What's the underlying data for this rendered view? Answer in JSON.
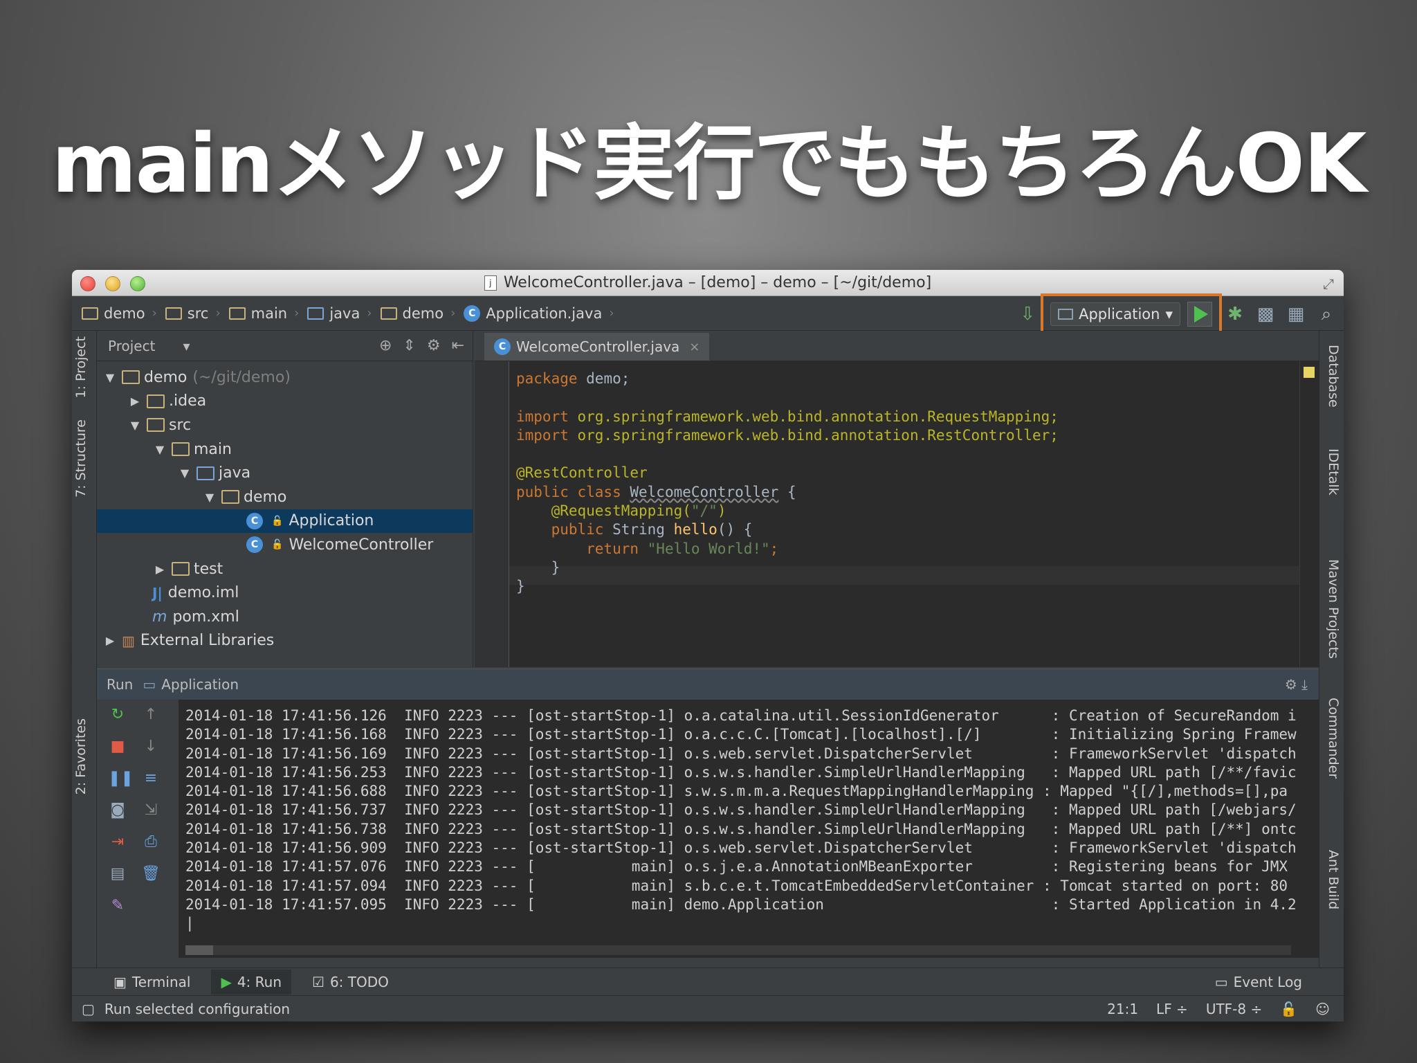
{
  "slide": {
    "title": "mainメソッド実行でももちろんOK"
  },
  "window": {
    "title": "WelcomeController.java – [demo] – demo – [~/git/demo]"
  },
  "breadcrumb": [
    "demo",
    "src",
    "main",
    "java",
    "demo",
    "Application.java"
  ],
  "toolbar": {
    "run_config": "Application"
  },
  "left_tabs": [
    "1: Project",
    "7: Structure",
    "2: Favorites"
  ],
  "right_tabs": [
    "Database",
    "IDEtalk",
    "Maven Projects",
    "Commander",
    "Ant Build"
  ],
  "project_panel": {
    "header": "Project",
    "tree": [
      {
        "label": "demo",
        "extra": "(~/git/demo)",
        "arrow": "▼",
        "icon": "module"
      },
      {
        "label": ".idea",
        "arrow": "▶",
        "icon": "folder"
      },
      {
        "label": "src",
        "arrow": "▼",
        "icon": "folder"
      },
      {
        "label": "main",
        "arrow": "▼",
        "icon": "folder"
      },
      {
        "label": "java",
        "arrow": "▼",
        "icon": "folder-blue"
      },
      {
        "label": "demo",
        "arrow": "▼",
        "icon": "folder"
      },
      {
        "label": "Application",
        "arrow": "",
        "icon": "class",
        "selected": true
      },
      {
        "label": "WelcomeController",
        "arrow": "",
        "icon": "class"
      },
      {
        "label": "test",
        "arrow": "▶",
        "icon": "folder"
      },
      {
        "label": "demo.iml",
        "arrow": "",
        "icon": "iml"
      },
      {
        "label": "pom.xml",
        "arrow": "",
        "icon": "maven"
      },
      {
        "label": "External Libraries",
        "arrow": "▶",
        "icon": "library"
      }
    ]
  },
  "editor": {
    "tab": "WelcomeController.java",
    "code": {
      "l1_kw": "package",
      "l1_rest": " demo;",
      "l3_kw": "import",
      "l3_rest": " org.springframework.web.bind.annotation.RequestMapping;",
      "l4_kw": "import",
      "l4_rest": " org.springframework.web.bind.annotation.RestController;",
      "l6_ann": "@RestController",
      "l7_kw": "public class ",
      "l7_name": "WelcomeController",
      "l7_rest": " {",
      "l8_ann": "    @RequestMapping(",
      "l8_str": "\"/\"",
      "l8_end": ")",
      "l9_kw": "    public ",
      "l9_type": "String ",
      "l9_fn": "hello",
      "l9_rest": "() {",
      "l10_kw": "        return ",
      "l10_str": "\"Hello World!\"",
      "l10_end": ";",
      "l11": "    }",
      "l12": "}"
    }
  },
  "run_panel": {
    "label_run": "Run",
    "label_config": "Application",
    "log": [
      "2014-01-18 17:41:56.126  INFO 2223 --- [ost-startStop-1] o.a.catalina.util.SessionIdGenerator      : Creation of SecureRandom i",
      "2014-01-18 17:41:56.168  INFO 2223 --- [ost-startStop-1] o.a.c.c.C.[Tomcat].[localhost].[/]        : Initializing Spring Framew",
      "2014-01-18 17:41:56.169  INFO 2223 --- [ost-startStop-1] o.s.web.servlet.DispatcherServlet         : FrameworkServlet 'dispatch",
      "2014-01-18 17:41:56.253  INFO 2223 --- [ost-startStop-1] o.s.w.s.handler.SimpleUrlHandlerMapping   : Mapped URL path [/**/favic",
      "2014-01-18 17:41:56.688  INFO 2223 --- [ost-startStop-1] s.w.s.m.m.a.RequestMappingHandlerMapping : Mapped \"{[/],methods=[],pa",
      "2014-01-18 17:41:56.737  INFO 2223 --- [ost-startStop-1] o.s.w.s.handler.SimpleUrlHandlerMapping   : Mapped URL path [/webjars/",
      "2014-01-18 17:41:56.738  INFO 2223 --- [ost-startStop-1] o.s.w.s.handler.SimpleUrlHandlerMapping   : Mapped URL path [/**] ontc",
      "2014-01-18 17:41:56.909  INFO 2223 --- [ost-startStop-1] o.s.web.servlet.DispatcherServlet         : FrameworkServlet 'dispatch",
      "2014-01-18 17:41:57.076  INFO 2223 --- [           main] o.s.j.e.a.AnnotationMBeanExporter         : Registering beans for JMX ",
      "2014-01-18 17:41:57.094  INFO 2223 --- [           main] s.b.c.e.t.TomcatEmbeddedServletContainer : Tomcat started on port: 80",
      "2014-01-18 17:41:57.095  INFO 2223 --- [           main] demo.Application                          : Started Application in 4.2",
      "|"
    ]
  },
  "bottom_tabs": {
    "terminal": "Terminal",
    "run": "4: Run",
    "todo": "6: TODO",
    "event_log": "Event Log"
  },
  "status": {
    "message": "Run selected configuration",
    "position": "21:1",
    "line_sep": "LF ÷",
    "encoding": "UTF-8 ÷"
  }
}
